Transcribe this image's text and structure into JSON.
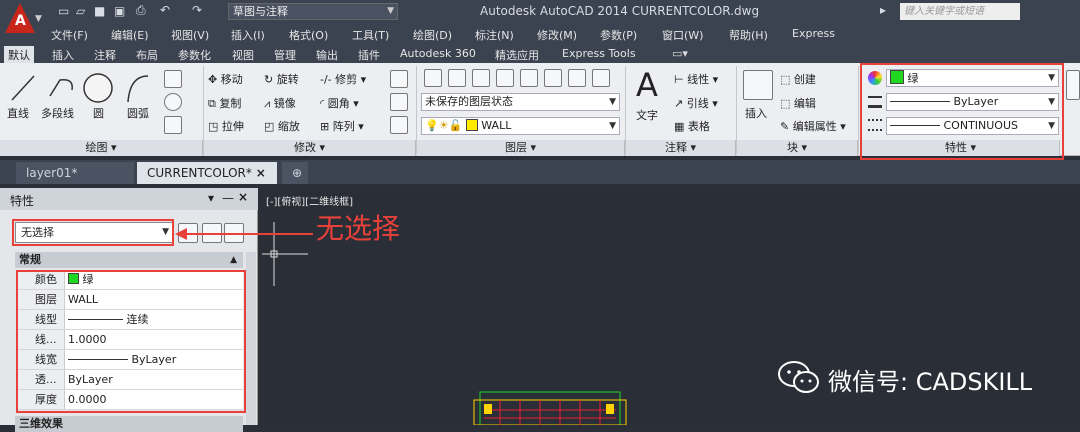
{
  "title_bar": {
    "app_title": "Autodesk AutoCAD 2014    CURRENTCOLOR.dwg",
    "workspace": "草图与注释",
    "search_placeholder": "键入关键字或短语",
    "app_letter": "A"
  },
  "menu": [
    "文件(F)",
    "编辑(E)",
    "视图(V)",
    "插入(I)",
    "格式(O)",
    "工具(T)",
    "绘图(D)",
    "标注(N)",
    "修改(M)",
    "参数(P)",
    "窗口(W)",
    "帮助(H)",
    "Express"
  ],
  "ribbon_tabs": [
    "默认",
    "插入",
    "注释",
    "布局",
    "参数化",
    "视图",
    "管理",
    "输出",
    "插件",
    "Autodesk 360",
    "精选应用",
    "Express Tools"
  ],
  "draw_panel": {
    "line": "直线",
    "polyline": "多段线",
    "circle": "圆",
    "arc": "圆弧",
    "footer": "绘图"
  },
  "modify_panel": {
    "move": "移动",
    "rotate": "旋转",
    "trim": "修剪",
    "copy": "复制",
    "mirror": "镜像",
    "fillet": "圆角",
    "stretch": "拉伸",
    "scale": "缩放",
    "array": "阵列",
    "footer": "修改"
  },
  "layers_panel": {
    "layer_state": "未保存的图层状态",
    "current_layer": "WALL",
    "footer": "图层"
  },
  "annotation_panel": {
    "text": "文字",
    "linear": "线性",
    "leader": "引线",
    "table": "表格",
    "footer": "注释"
  },
  "block_panel": {
    "insert": "插入",
    "create": "创建",
    "edit": "编辑",
    "edit_attr": "编辑属性",
    "footer": "块"
  },
  "properties_panel": {
    "color": "绿",
    "lineweight": "ByLayer",
    "linetype": "CONTINUOUS",
    "footer": "特性"
  },
  "doc_tabs": [
    "layer01*",
    "CURRENTCOLOR*"
  ],
  "palette": {
    "title": "特性",
    "selection": "无选择",
    "section_general": "常规",
    "section_3d": "三维效果",
    "rows": [
      {
        "k": "颜色",
        "v": "绿"
      },
      {
        "k": "图层",
        "v": "WALL"
      },
      {
        "k": "线型",
        "v": "连续"
      },
      {
        "k": "线...",
        "v": "1.0000"
      },
      {
        "k": "线宽",
        "v": "ByLayer"
      },
      {
        "k": "透...",
        "v": "ByLayer"
      },
      {
        "k": "厚度",
        "v": "0.0000"
      }
    ]
  },
  "viewport_label": "[-][俯视][二维线框]",
  "annotation": "无选择",
  "watermark": "微信号: CADSKILL",
  "colors": {
    "green": "#1fd81f",
    "red": "#e8413a",
    "dark": "#2a2e37"
  }
}
